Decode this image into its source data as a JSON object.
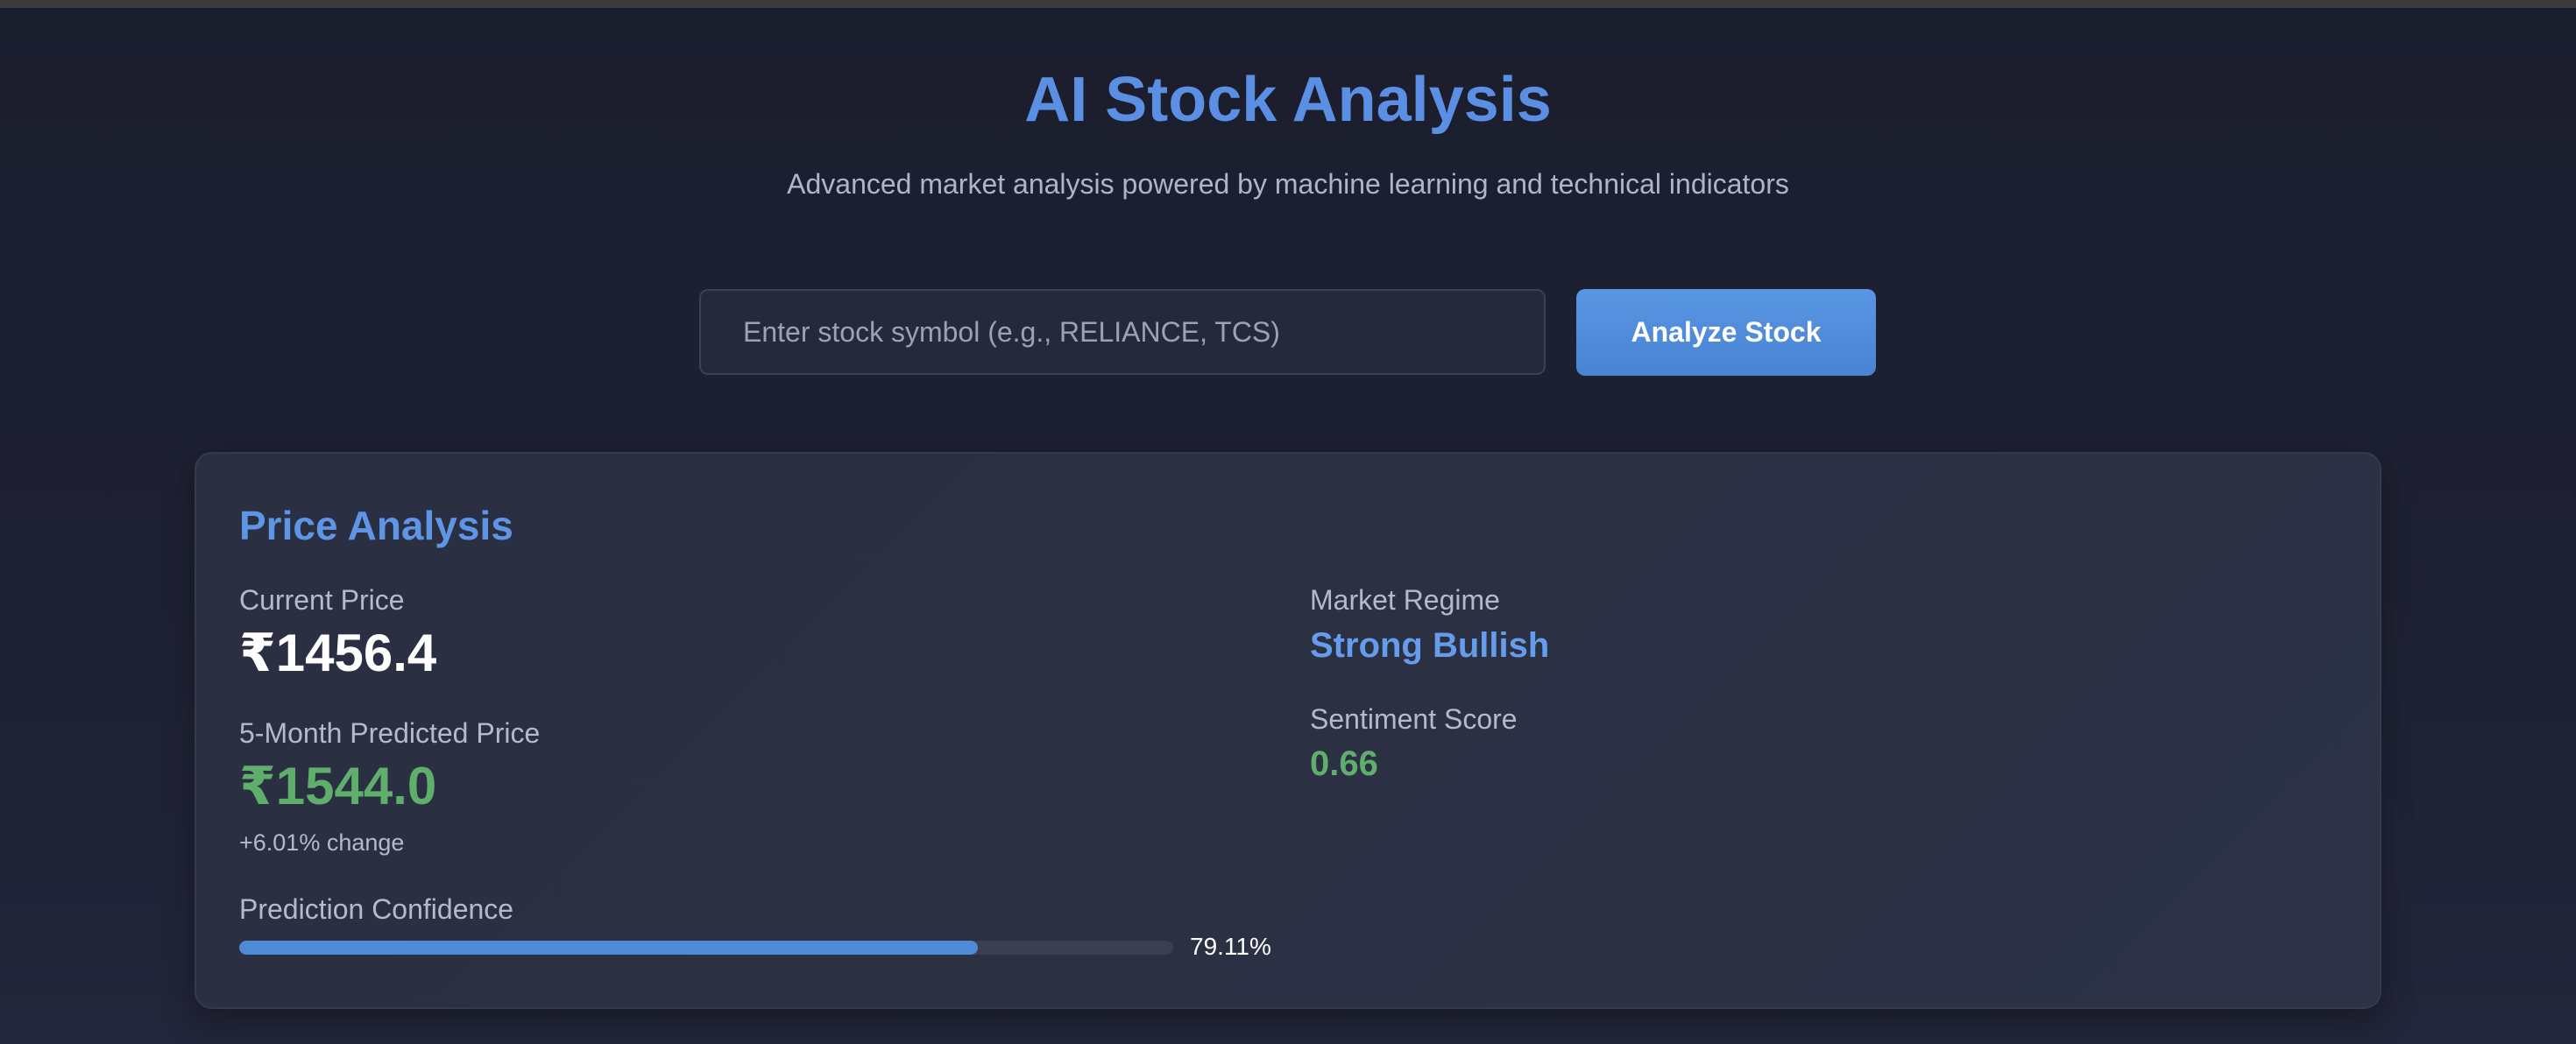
{
  "header": {
    "title": "AI Stock Analysis",
    "subtitle": "Advanced market analysis powered by machine learning and technical indicators"
  },
  "search": {
    "placeholder": "Enter stock symbol (e.g., RELIANCE, TCS)",
    "value": "",
    "button_label": "Analyze Stock"
  },
  "price_analysis": {
    "title": "Price Analysis",
    "current_price_label": "Current Price",
    "current_price": "₹1456.4",
    "predicted_price_label": "5-Month Predicted Price",
    "predicted_price": "₹1544.0",
    "change_text": "+6.01% change",
    "confidence_label": "Prediction Confidence",
    "confidence_value": 79.11,
    "confidence_text": "79.11%",
    "market_regime_label": "Market Regime",
    "market_regime": "Strong Bullish",
    "sentiment_label": "Sentiment Score",
    "sentiment_score": "0.66"
  },
  "colors": {
    "accent_blue": "#5b8fe3",
    "positive_green": "#5fae6c",
    "background": "#1e2133",
    "card": "#2b3043"
  }
}
